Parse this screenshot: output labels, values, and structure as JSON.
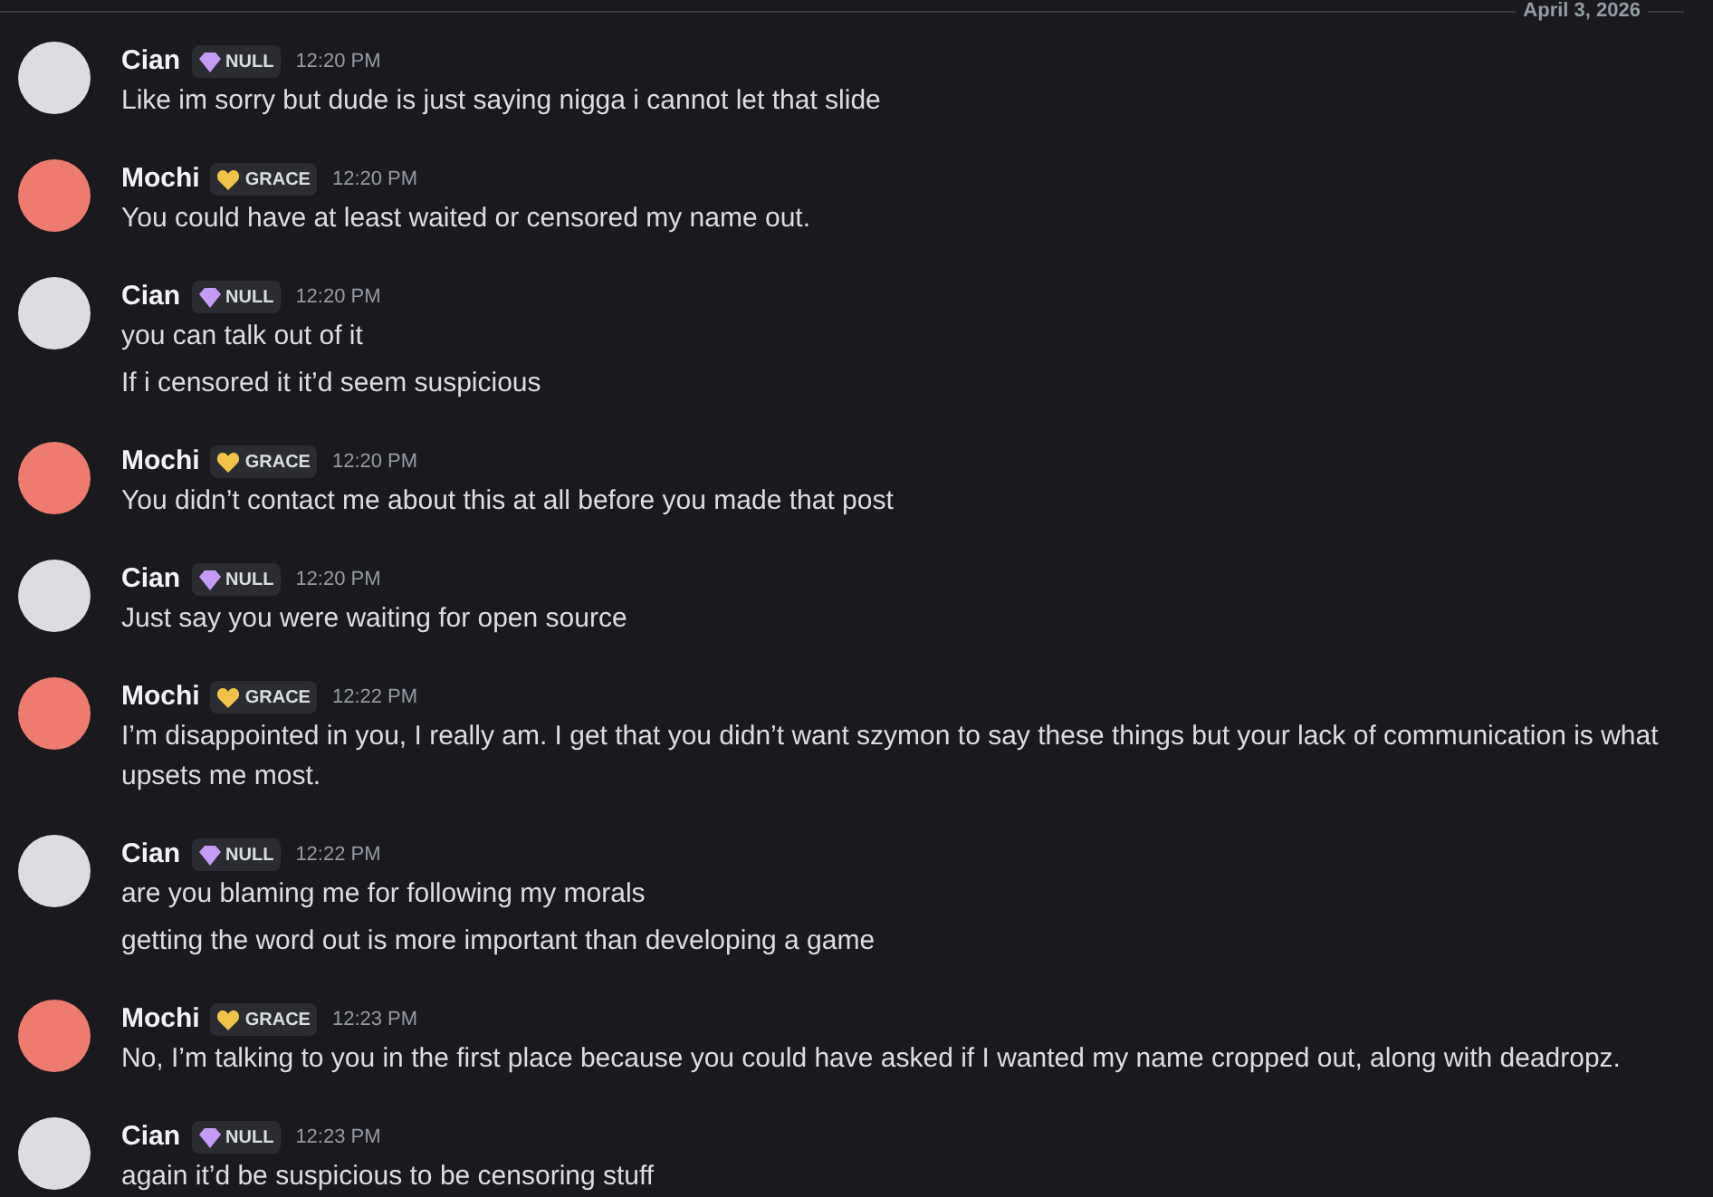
{
  "date_divider": "April 3, 2026",
  "messages": [
    {
      "author": "Cian",
      "avatar": {
        "color": "#dcdde3"
      },
      "badge": {
        "kind": "gem",
        "label": "NULL"
      },
      "time": "12:20 PM",
      "lines": [
        "Like im sorry but dude is just saying nigga i cannot let that slide"
      ]
    },
    {
      "author": "Mochi",
      "avatar": {
        "color": "#ee7b70"
      },
      "badge": {
        "kind": "heart",
        "label": "GRACE"
      },
      "time": "12:20 PM",
      "lines": [
        "You could have at least waited or censored my name out."
      ]
    },
    {
      "author": "Cian",
      "avatar": {
        "color": "#dcdde3"
      },
      "badge": {
        "kind": "gem",
        "label": "NULL"
      },
      "time": "12:20 PM",
      "lines": [
        "you can talk out of it",
        "If i censored it it’d seem suspicious"
      ]
    },
    {
      "author": "Mochi",
      "avatar": {
        "color": "#ee7b70"
      },
      "badge": {
        "kind": "heart",
        "label": "GRACE"
      },
      "time": "12:20 PM",
      "lines": [
        "You didn’t contact me about this at all before you made that post"
      ]
    },
    {
      "author": "Cian",
      "avatar": {
        "color": "#dcdde3"
      },
      "badge": {
        "kind": "gem",
        "label": "NULL"
      },
      "time": "12:20 PM",
      "lines": [
        "Just say you were waiting for open source"
      ]
    },
    {
      "author": "Mochi",
      "avatar": {
        "color": "#ee7b70"
      },
      "badge": {
        "kind": "heart",
        "label": "GRACE"
      },
      "time": "12:22 PM",
      "lines": [
        "I’m disappointed in you, I really am. I get that you didn’t want szymon to say these things but your lack of communication is what upsets me most."
      ]
    },
    {
      "author": "Cian",
      "avatar": {
        "color": "#dcdde3"
      },
      "badge": {
        "kind": "gem",
        "label": "NULL"
      },
      "time": "12:22 PM",
      "lines": [
        "are you blaming me for following my morals",
        "getting the word out is more important than developing a game"
      ]
    },
    {
      "author": "Mochi",
      "avatar": {
        "color": "#ee7b70"
      },
      "badge": {
        "kind": "heart",
        "label": "GRACE"
      },
      "time": "12:23 PM",
      "lines": [
        "No, I’m talking to you in the first place because you could have asked if I wanted my name cropped out, along with deadropz."
      ]
    },
    {
      "author": "Cian",
      "avatar": {
        "color": "#dcdde3"
      },
      "badge": {
        "kind": "gem",
        "label": "NULL"
      },
      "time": "12:23 PM",
      "lines": [
        "again it’d be suspicious to be censoring stuff"
      ]
    }
  ]
}
